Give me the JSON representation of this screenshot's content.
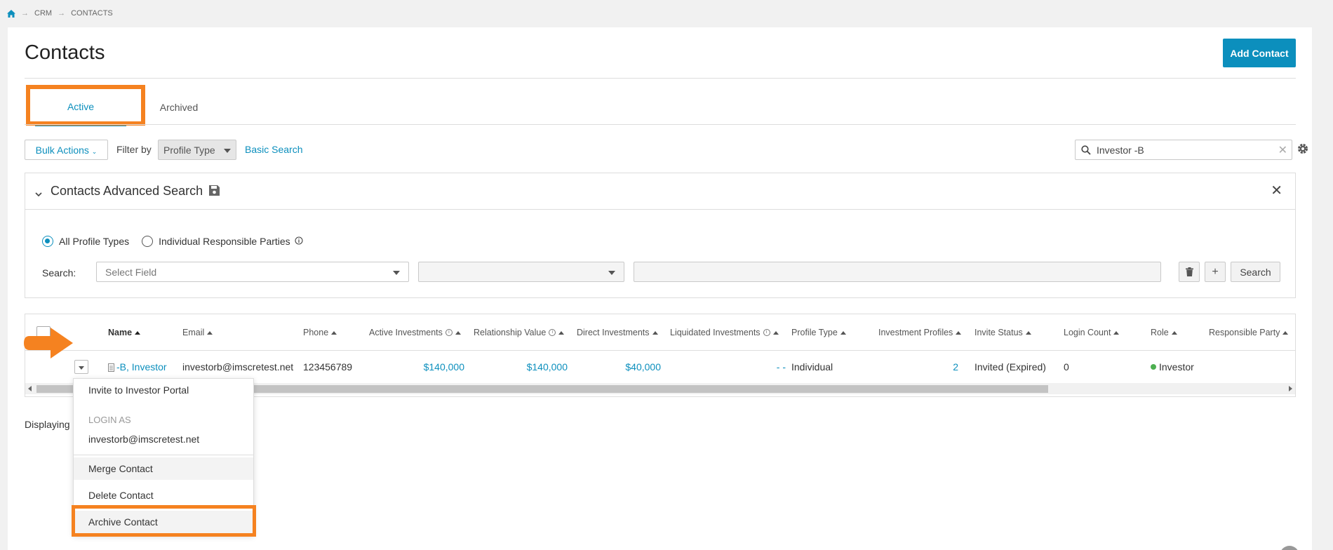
{
  "breadcrumb": {
    "items": [
      "CRM",
      "CONTACTS"
    ]
  },
  "page": {
    "title": "Contacts",
    "add_button": "Add Contact"
  },
  "tabs": [
    {
      "label": "Active"
    },
    {
      "label": "Archived"
    }
  ],
  "toolbar": {
    "bulk_actions": "Bulk Actions",
    "filter_label": "Filter by",
    "profile_type": "Profile Type",
    "basic_search": "Basic Search",
    "search_value": "Investor -B"
  },
  "advanced_search": {
    "title": "Contacts Advanced Search",
    "radio_all": "All Profile Types",
    "radio_individual": "Individual Responsible Parties",
    "search_label": "Search:",
    "field_placeholder": "Select Field",
    "search_button": "Search"
  },
  "table": {
    "columns": [
      "Name",
      "Email",
      "Phone",
      "Active Investments",
      "Relationship Value",
      "Direct Investments",
      "Liquidated Investments",
      "Profile Type",
      "Investment Profiles",
      "Invite Status",
      "Login Count",
      "Role",
      "Responsible Party"
    ],
    "row": {
      "name": "-B, Investor",
      "email": "investorb@imscretest.net",
      "phone": "123456789",
      "active_investments": "$140,000",
      "relationship_value": "$140,000",
      "direct_investments": "$40,000",
      "liquidated_investments": "- -",
      "profile_type": "Individual",
      "investment_profiles": "2",
      "invite_status": "Invited (Expired)",
      "login_count": "0",
      "role": "Investor"
    }
  },
  "footer": {
    "displaying": "Displaying"
  },
  "context_menu": {
    "invite": "Invite to Investor Portal",
    "login_as_header": "LOGIN AS",
    "login_email": "investorb@imscretest.net",
    "merge": "Merge Contact",
    "delete": "Delete Contact",
    "archive": "Archive Contact"
  },
  "colors": {
    "accent": "#0c8fbd",
    "highlight": "#f58220",
    "role_dot": "#4caf50"
  }
}
